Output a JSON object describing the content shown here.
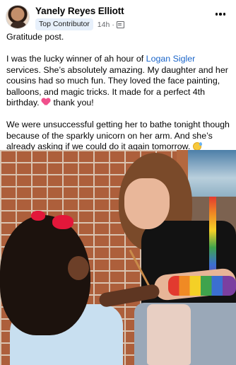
{
  "post": {
    "author": "Yanely Reyes Elliott",
    "badge": "Top Contributor",
    "time": "14h",
    "separator": "·",
    "audience_icon": "group-icon",
    "more_icon": "more-options-icon"
  },
  "body": {
    "line1": "Gratitude post.",
    "p2_before": "I was the lucky winner of ah hour of ",
    "p2_mention": "Logan Sigler",
    "p2_after": " services. She’s absolutely amazing. My daughter and her cousins had so much fun. They loved the face painting, balloons, and magic tricks.  It made for a perfect 4th birthday. ",
    "p2_end": " thank you!",
    "p3": "We were unsuccessful getting her to bathe tonight though because of the sparkly unicorn on her arm. And she’s already asking if we could do it again tomorrow. ",
    "heart_emoji": "sparkling-heart-emoji",
    "sweat_emoji": "grinning-sweat-emoji"
  },
  "photo": {
    "subject": "face-painting-photo"
  }
}
